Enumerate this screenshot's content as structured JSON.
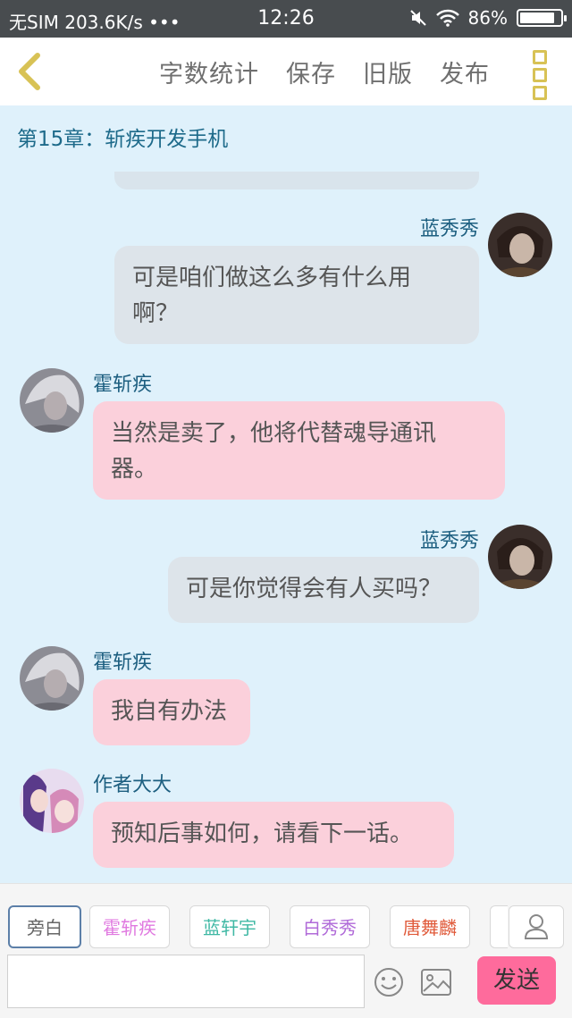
{
  "status_bar": {
    "carrier": "无SIM",
    "speed": "203.6K/s •••",
    "time": "12:26",
    "battery": "86%",
    "battery_level": 0.86
  },
  "toolbar": {
    "word_count": "字数统计",
    "save": "保存",
    "old_version": "旧版",
    "publish": "发布"
  },
  "chapter_title": "第15章：斩疾开发手机",
  "messages": [
    {
      "side": "right",
      "name": "蓝秀秀",
      "lines": [
        "可是咱们做这么多有什么用",
        "啊？"
      ]
    },
    {
      "side": "left",
      "name": "霍斩疾",
      "lines": [
        "当然是卖了，他将代替魂导通讯",
        "器。"
      ]
    },
    {
      "side": "right",
      "name": "蓝秀秀",
      "lines": [
        "可是你觉得会有人买吗？"
      ]
    },
    {
      "side": "left",
      "name": "霍斩疾",
      "lines": [
        "我自有办法"
      ]
    },
    {
      "side": "left",
      "name": "作者大大",
      "lines": [
        "预知后事如何，请看下一话。"
      ]
    }
  ],
  "characters": [
    {
      "label": "旁白",
      "color": "#666666"
    },
    {
      "label": "霍斩疾",
      "color": "#e07ae0"
    },
    {
      "label": "蓝轩宇",
      "color": "#3fb8a4"
    },
    {
      "label": "白秀秀",
      "color": "#b06ad8"
    },
    {
      "label": "唐舞麟",
      "color": "#e05a3a"
    }
  ],
  "input": {
    "value": "",
    "placeholder": ""
  },
  "send_label": "发送",
  "colors": {
    "accent": "#fe6b9c",
    "background": "#dff1fb",
    "name_text": "#1d5f80",
    "gray_bubble": "#dde4ea",
    "pink_bubble": "#fbd0db"
  },
  "icons": [
    "back-chevron-icon",
    "more-menu-icon",
    "user-icon",
    "emoji-icon",
    "image-icon"
  ]
}
